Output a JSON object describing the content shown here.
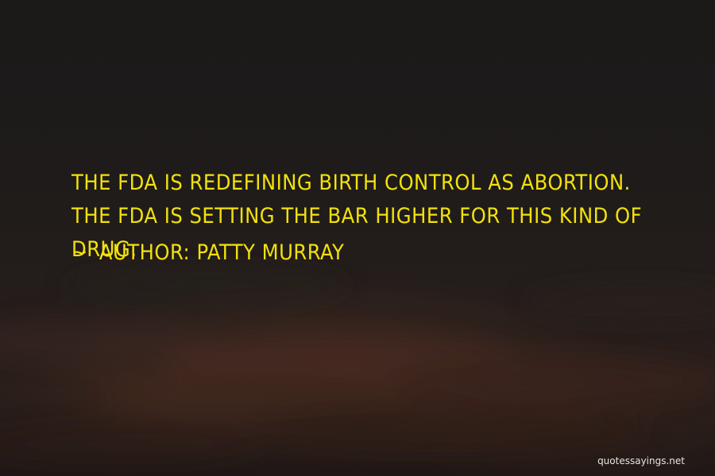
{
  "quote": {
    "text": "THE FDA IS REDEFINING BIRTH CONTROL AS ABORTION. THE FDA IS SETTING THE BAR HIGHER FOR THIS KIND OF DRUG.",
    "author_prefix": "~",
    "author_label": "Author:",
    "author_name": "Patty Murray"
  },
  "watermark": {
    "text": "quotessayings.net"
  },
  "colors": {
    "quote_text": "#f2e10c",
    "background": "#1e1b1a",
    "watermark": "#e8e4df"
  }
}
